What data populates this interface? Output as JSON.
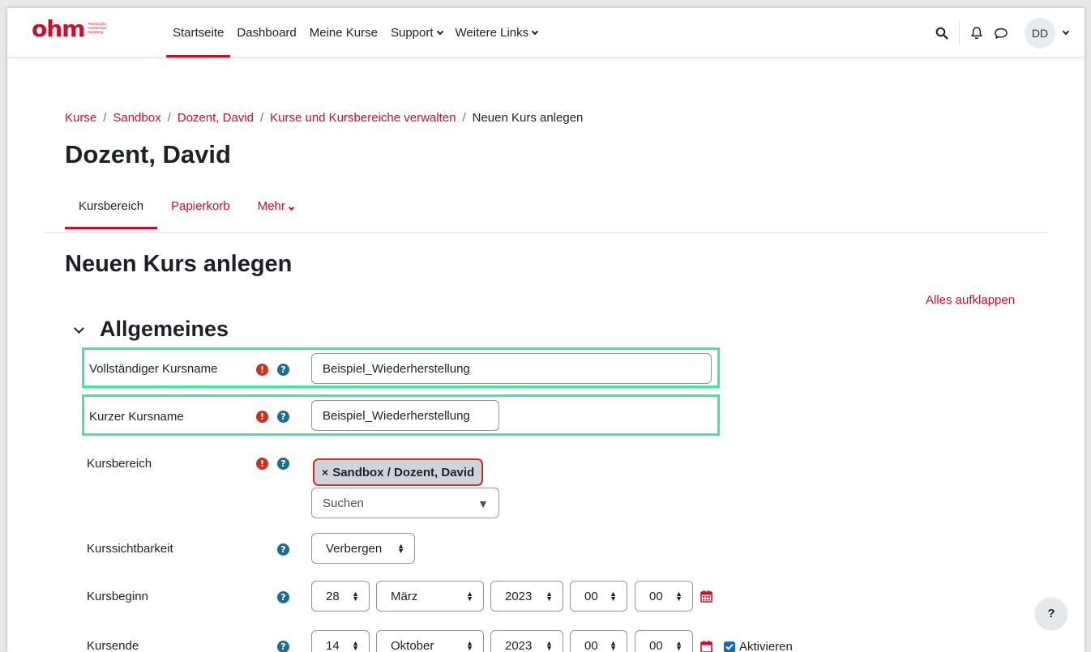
{
  "navbar": {
    "logo_text": "ohm",
    "logo_subtext": "Technische Hochschule Nürnberg",
    "links": [
      {
        "label": "Startseite",
        "active": true
      },
      {
        "label": "Dashboard"
      },
      {
        "label": "Meine Kurse"
      },
      {
        "label": "Support",
        "dropdown": true
      },
      {
        "label": "Weitere Links",
        "dropdown": true
      }
    ],
    "user_initials": "DD"
  },
  "breadcrumb": {
    "items": [
      "Kurse",
      "Sandbox",
      "Dozent, David",
      "Kurse und Kursbereiche verwalten"
    ],
    "current": "Neuen Kurs anlegen"
  },
  "page_title": "Dozent, David",
  "tabs": [
    {
      "label": "Kursbereich",
      "active": true
    },
    {
      "label": "Papierkorb"
    },
    {
      "label": "Mehr",
      "dropdown": true
    }
  ],
  "section_title": "Neuen Kurs anlegen",
  "expand_all_label": "Alles aufklappen",
  "fieldset_title": "Allgemeines",
  "form": {
    "fullname": {
      "label": "Vollständiger Kursname",
      "value": "Beispiel_Wiederherstellung"
    },
    "shortname": {
      "label": "Kurzer Kursname",
      "value": "Beispiel_Wiederherstellung"
    },
    "category": {
      "label": "Kursbereich",
      "selected": "Sandbox / Dozent, David",
      "search_placeholder": "Suchen"
    },
    "visibility": {
      "label": "Kurssichtbarkeit",
      "value": "Verbergen"
    },
    "startdate": {
      "label": "Kursbeginn",
      "day": "28",
      "month": "März",
      "year": "2023",
      "hour": "00",
      "minute": "00"
    },
    "enddate": {
      "label": "Kursende",
      "day": "14",
      "month": "Oktober",
      "year": "2023",
      "hour": "00",
      "minute": "00",
      "enable_label": "Aktivieren",
      "enabled": true
    }
  },
  "help_button": "?",
  "colors": {
    "brand": "#c8102e",
    "highlight": "#3ee8a2",
    "required": "#ca3120",
    "help": "#1a6e8e"
  }
}
